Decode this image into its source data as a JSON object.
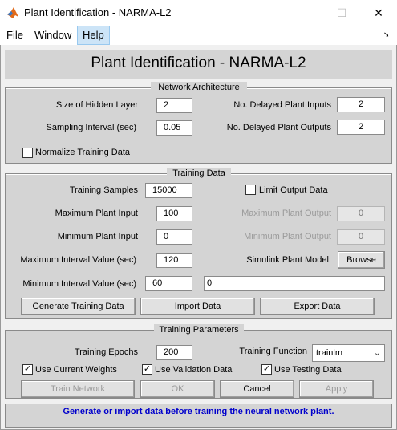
{
  "window": {
    "title": "Plant Identification - NARMA-L2"
  },
  "menu": {
    "file": "File",
    "window": "Window",
    "help": "Help"
  },
  "page_title": "Plant Identification - NARMA-L2",
  "network_architecture": {
    "title": "Network Architecture",
    "hidden_layer_label": "Size of Hidden Layer",
    "hidden_layer_value": "2",
    "sampling_label": "Sampling Interval (sec)",
    "sampling_value": "0.05",
    "normalize_label": "Normalize Training Data",
    "normalize_checked": false,
    "delayed_inputs_label": "No. Delayed Plant Inputs",
    "delayed_inputs_value": "2",
    "delayed_outputs_label": "No. Delayed Plant Outputs",
    "delayed_outputs_value": "2"
  },
  "training_data": {
    "title": "Training Data",
    "samples_label": "Training Samples",
    "samples_value": "15000",
    "max_input_label": "Maximum Plant Input",
    "max_input_value": "100",
    "min_input_label": "Minimum Plant Input",
    "min_input_value": "0",
    "max_interval_label": "Maximum Interval Value (sec)",
    "max_interval_value": "120",
    "min_interval_label": "Minimum Interval Value (sec)",
    "min_interval_value": "60",
    "limit_output_label": "Limit Output Data",
    "limit_output_checked": false,
    "max_output_label": "Maximum Plant Output",
    "max_output_value": "0",
    "min_output_label": "Minimum Plant Output",
    "min_output_value": "0",
    "simulink_label": "Simulink Plant Model:",
    "browse_label": "Browse",
    "model_path_value": "0",
    "generate_label": "Generate Training Data",
    "import_label": "Import Data",
    "export_label": "Export Data"
  },
  "training_parameters": {
    "title": "Training Parameters",
    "epochs_label": "Training Epochs",
    "epochs_value": "200",
    "function_label": "Training Function",
    "function_value": "trainlm",
    "use_current_weights": "Use Current Weights",
    "use_validation": "Use Validation Data",
    "use_testing": "Use Testing Data",
    "check_mark": "✓",
    "train_label": "Train Network",
    "ok_label": "OK",
    "cancel_label": "Cancel",
    "apply_label": "Apply"
  },
  "status": "Generate or import data before training the neural network plant."
}
